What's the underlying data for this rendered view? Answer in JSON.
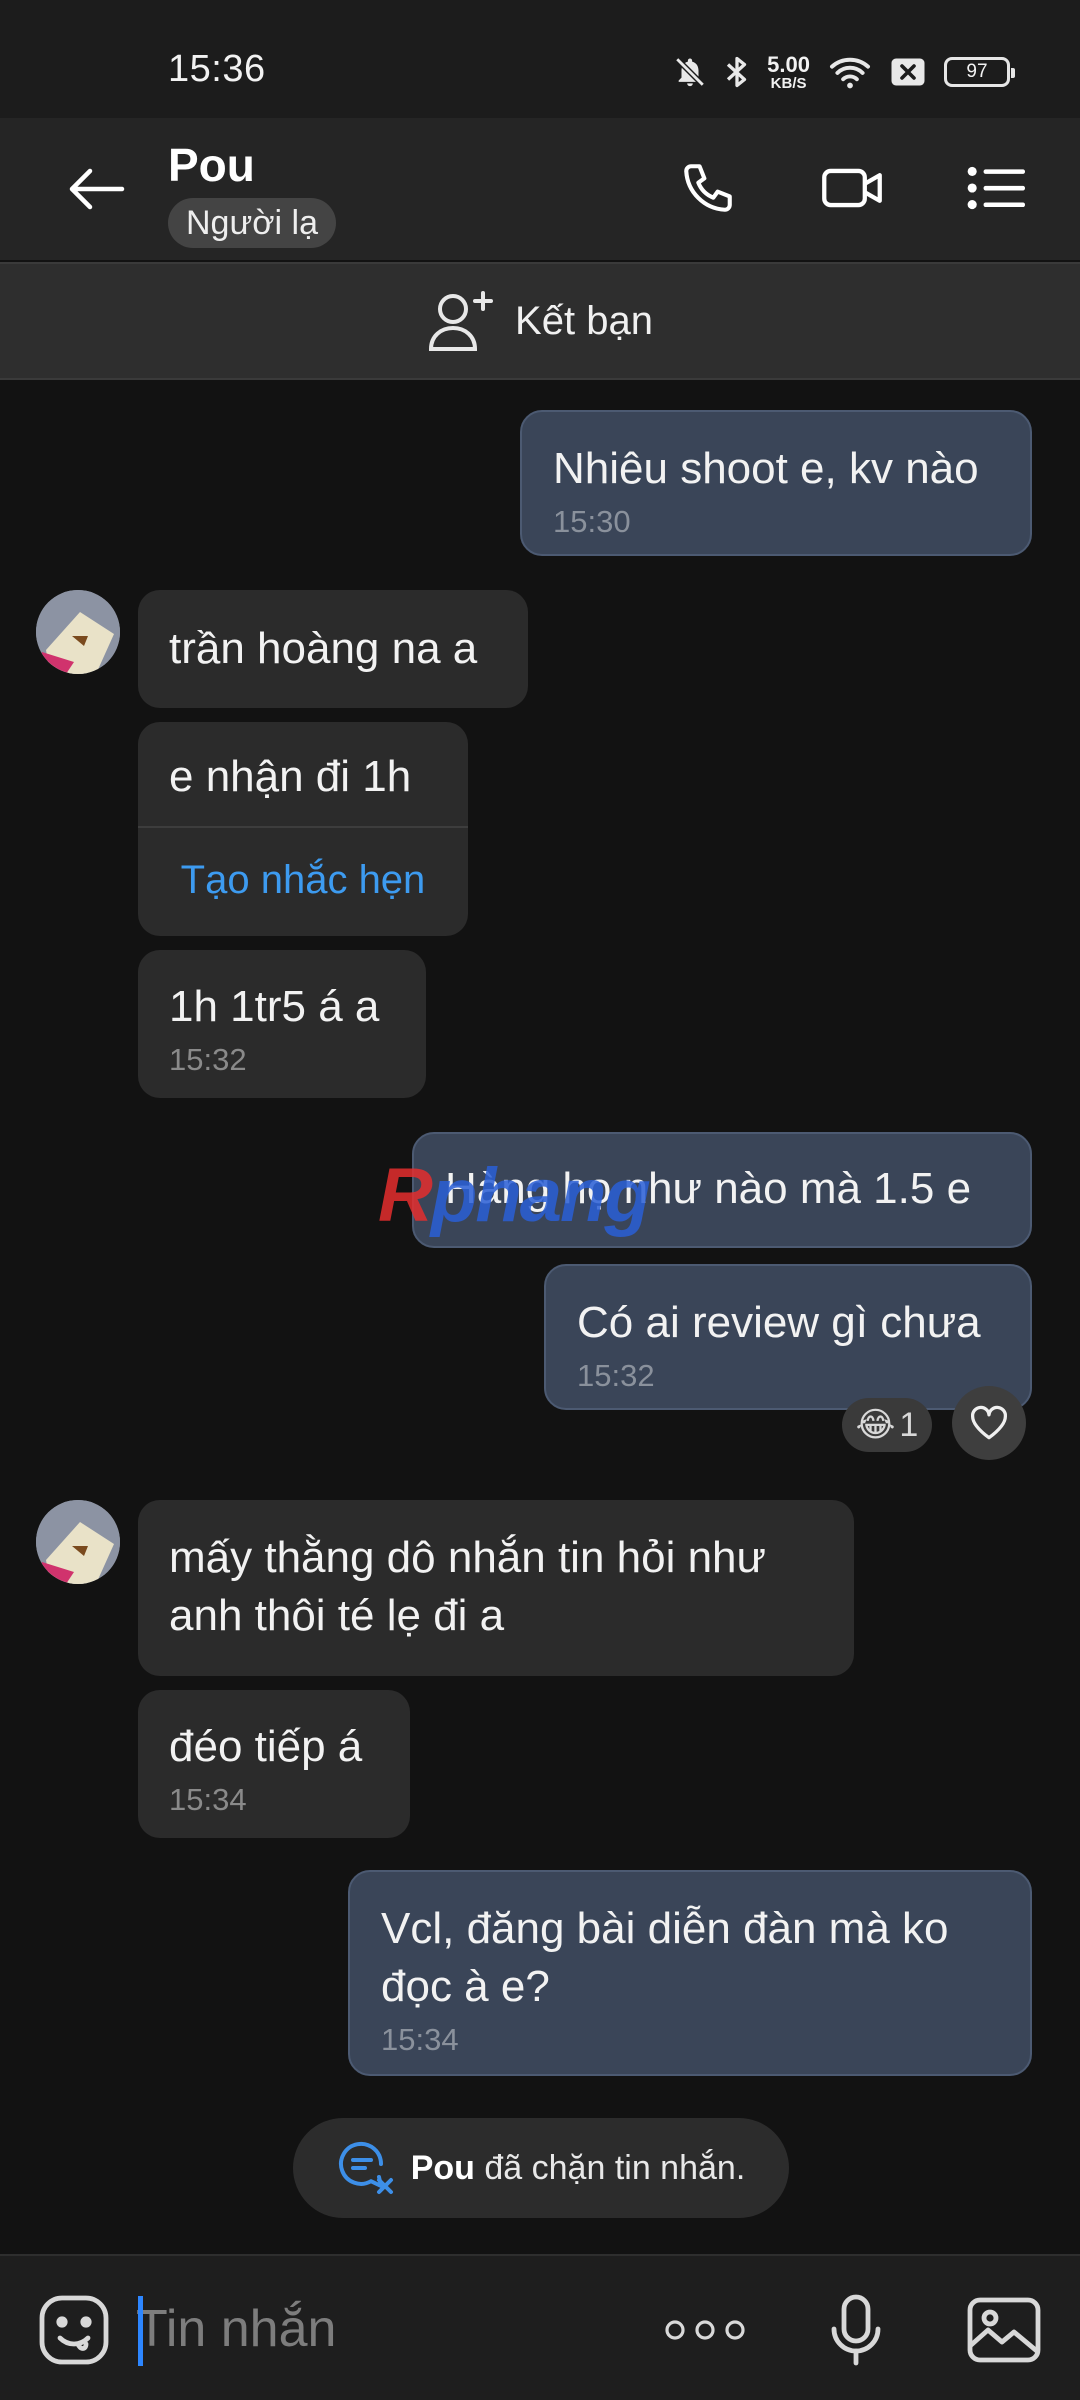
{
  "status_bar": {
    "time": "15:36",
    "net_speed_value": "5.00",
    "net_speed_unit": "KB/S",
    "battery": "97",
    "icons": [
      "bell-off-icon",
      "bluetooth-icon",
      "wifi-icon",
      "sim-blocked-icon",
      "battery-icon"
    ]
  },
  "header": {
    "contact_name": "Pou",
    "badge": "Người lạ",
    "icons": [
      "back-arrow-icon",
      "phone-icon",
      "video-camera-icon",
      "list-menu-icon"
    ]
  },
  "add_friend": {
    "label": "Kết bạn",
    "icon": "add-person-icon"
  },
  "messages": [
    {
      "dir": "out",
      "text": "Nhiêu shoot e, kv nào",
      "time": "15:30"
    },
    {
      "dir": "in",
      "text": "trần hoàng na a"
    },
    {
      "dir": "in",
      "text": "e nhận đi 1h",
      "action": "Tạo nhắc hẹn"
    },
    {
      "dir": "in",
      "text": "1h 1tr5 á a",
      "time": "15:32"
    },
    {
      "dir": "out",
      "text": "Hàng họ như nào mà 1.5 e"
    },
    {
      "dir": "out",
      "text": "Có ai review gì chưa",
      "time": "15:32"
    },
    {
      "dir": "in",
      "text": "mấy thằng dô nhắn tin hỏi như anh thôi té lẹ đi a"
    },
    {
      "dir": "in",
      "text": "đéo tiếp á",
      "time": "15:34"
    },
    {
      "dir": "out",
      "text": "Vcl, đăng bài diễn đàn mà ko đọc à e?",
      "time": "15:34"
    }
  ],
  "reaction": {
    "emoji": "😂",
    "count": "1"
  },
  "watermark": {
    "first": "R",
    "rest": "phang"
  },
  "blocked_notice": {
    "name": "Pou",
    "text": " đã chặn tin nhắn."
  },
  "input_bar": {
    "placeholder": "Tin nhắn"
  },
  "colors": {
    "background": "#121212",
    "outgoing_bubble": "#3a4558",
    "incoming_bubble": "#2b2b2b",
    "link": "#3d9bf0",
    "accent_cursor": "#2d86ff"
  }
}
